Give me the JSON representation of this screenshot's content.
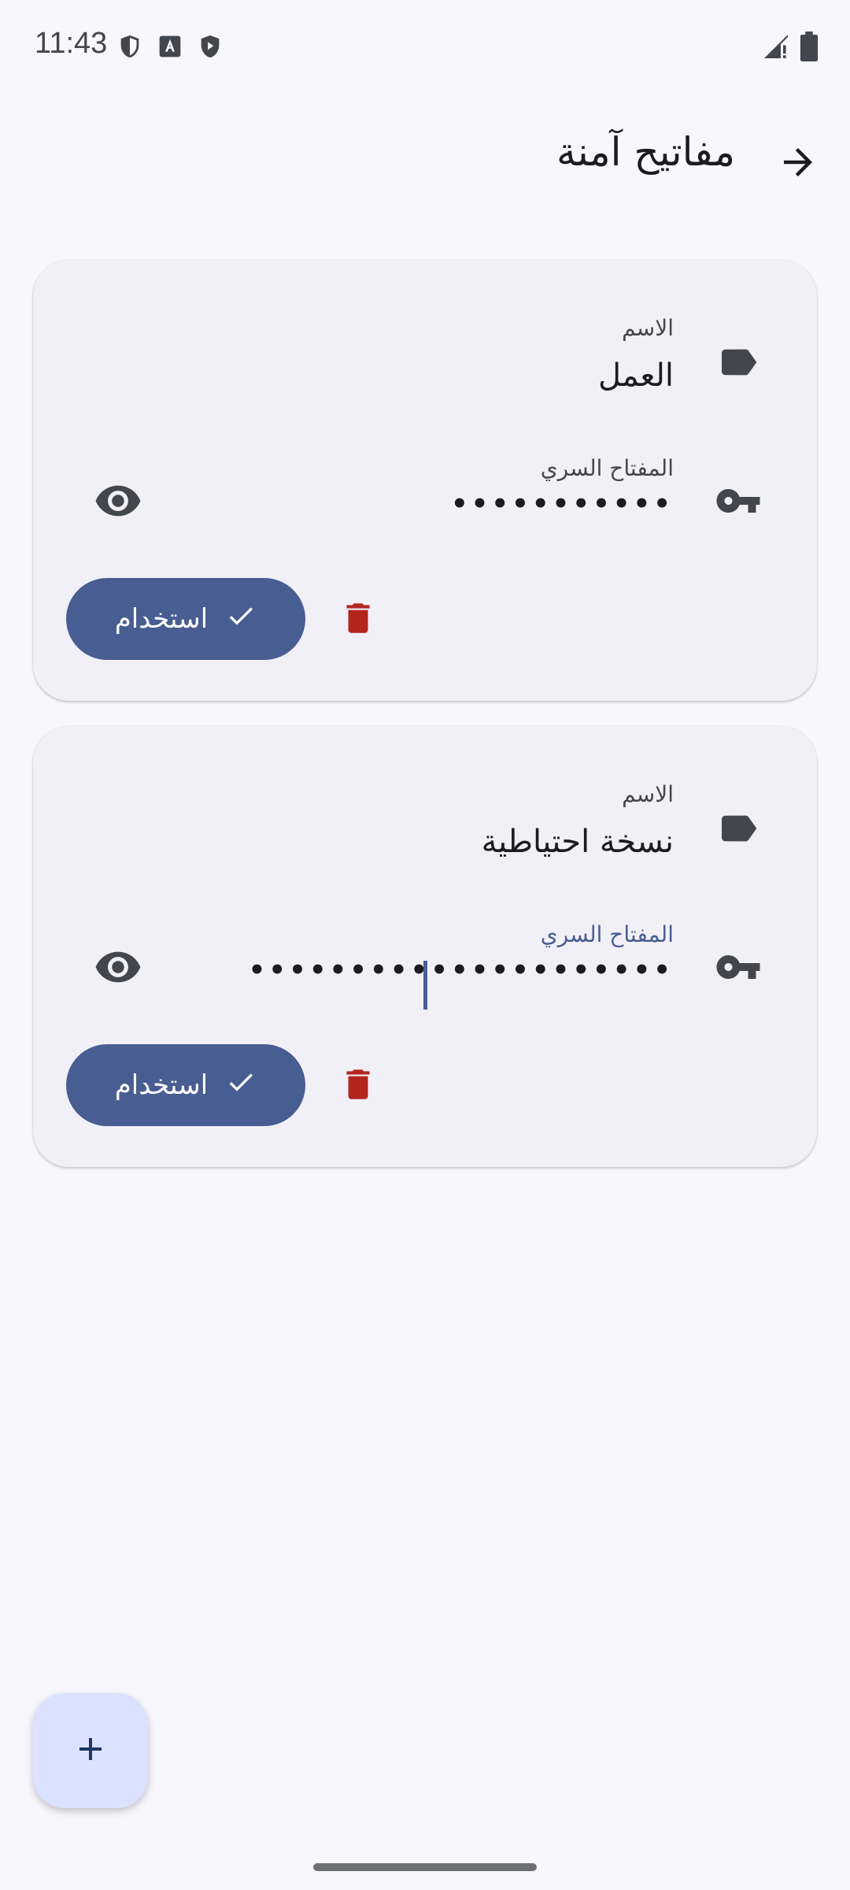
{
  "status_bar": {
    "time": "11:43",
    "icons_left": [
      "shield-outline-icon",
      "a-box-icon",
      "shield-play-icon"
    ],
    "icons_right": [
      "signal-icon",
      "battery-icon"
    ]
  },
  "header": {
    "title": "مفاتيح آمنة",
    "back_icon": "arrow-right-icon"
  },
  "cards": [
    {
      "name_label": "الاسم",
      "name_value": "العمل",
      "secret_label": "المفتاح السري",
      "secret_value": "•••••••••••",
      "use_label": "استخدام"
    },
    {
      "name_label": "الاسم",
      "name_value": "نسخة احتياطية",
      "secret_label": "المفتاح السري",
      "secret_value": "•••••••••••••••••••••",
      "use_label": "استخدام",
      "focused": true
    }
  ],
  "fab": {
    "icon": "plus-icon"
  },
  "colors": {
    "background": "#f8f7fd",
    "card": "#f2f0f7",
    "primary": "#485e92",
    "delete": "#b3261e",
    "icon": "#44464f",
    "fab": "#dae2ff"
  }
}
